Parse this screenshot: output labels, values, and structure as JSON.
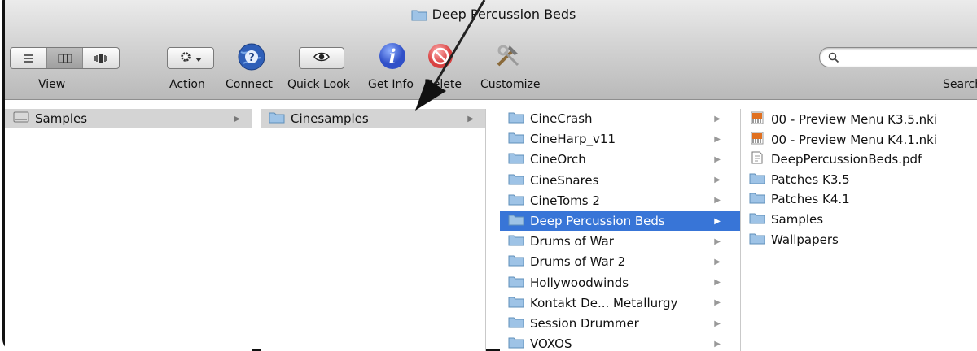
{
  "window": {
    "title": "Deep Percussion Beds"
  },
  "toolbar": {
    "view_label": "View",
    "action_label": "Action",
    "connect_label": "Connect",
    "quicklook_label": "Quick Look",
    "getinfo_label": "Get Info",
    "delete_label": "Delete",
    "customize_label": "Customize",
    "search_label": "Search",
    "view_modes": [
      "list-view-icon",
      "column-view-icon",
      "coverflow-view-icon"
    ],
    "selected_view_mode": "column-view-icon"
  },
  "columns": {
    "col1": [
      {
        "name": "Samples",
        "icon": "disk-icon",
        "has_children": true,
        "selected": true
      }
    ],
    "col2": [
      {
        "name": "Cinesamples",
        "icon": "folder-icon",
        "has_children": true,
        "selected": true
      }
    ],
    "col3": [
      {
        "name": "CineCrash",
        "icon": "folder-icon"
      },
      {
        "name": "CineHarp_v11",
        "icon": "folder-icon"
      },
      {
        "name": "CineOrch",
        "icon": "folder-icon"
      },
      {
        "name": "CineSnares",
        "icon": "folder-icon"
      },
      {
        "name": "CineToms 2",
        "icon": "folder-icon"
      },
      {
        "name": "Deep Percussion Beds",
        "icon": "folder-icon",
        "selected": true
      },
      {
        "name": "Drums of War",
        "icon": "folder-icon"
      },
      {
        "name": "Drums of War 2",
        "icon": "folder-icon"
      },
      {
        "name": "Hollywoodwinds",
        "icon": "folder-icon"
      },
      {
        "name": "Kontakt De... Metallurgy",
        "icon": "folder-icon"
      },
      {
        "name": "Session Drummer",
        "icon": "folder-icon"
      },
      {
        "name": "VOXOS",
        "icon": "folder-icon"
      }
    ],
    "col4": [
      {
        "name": "00 - Preview Menu K3.5.nki",
        "icon": "nki-file-icon"
      },
      {
        "name": "00 - Preview Menu K4.1.nki",
        "icon": "nki-file-icon"
      },
      {
        "name": "DeepPercussionBeds.pdf",
        "icon": "pdf-file-icon"
      },
      {
        "name": "Patches K3.5",
        "icon": "folder-icon"
      },
      {
        "name": "Patches K4.1",
        "icon": "folder-icon"
      },
      {
        "name": "Samples",
        "icon": "folder-icon"
      },
      {
        "name": "Wallpapers",
        "icon": "folder-icon"
      }
    ]
  },
  "colors": {
    "selection": "#3875d7",
    "inactive_selection": "#d4d4d4",
    "folder": "#9ec3e6"
  }
}
